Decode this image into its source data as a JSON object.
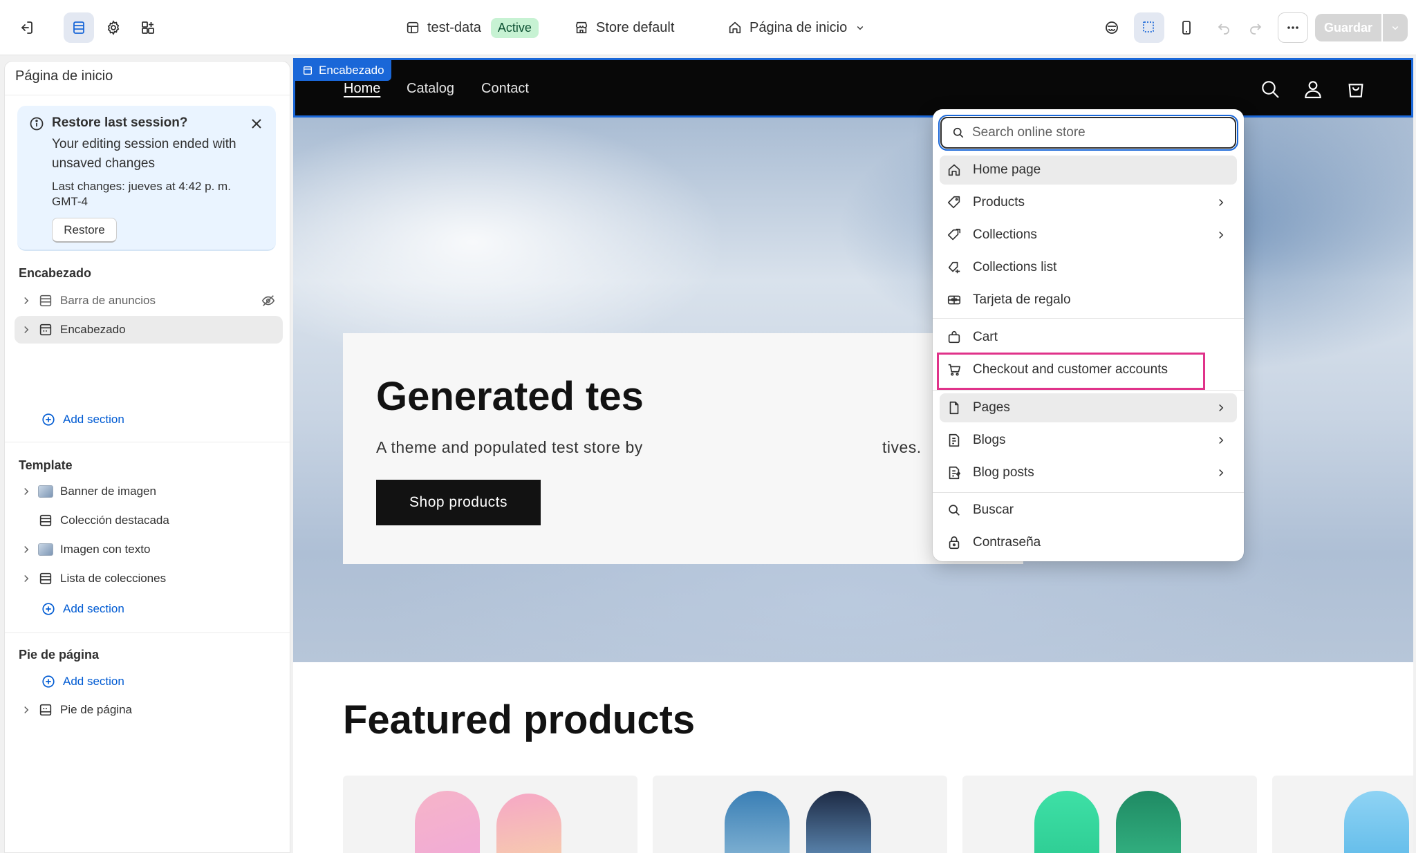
{
  "topbar": {
    "store_name": "test-data",
    "status_badge": "Active",
    "store_theme": "Store default",
    "page_selector": "Página de inicio",
    "save_label": "Guardar"
  },
  "sidebar": {
    "title": "Página de inicio",
    "restore": {
      "title": "Restore last session?",
      "message": "Your editing session ended with unsaved changes",
      "last_changes": "Last changes: jueves at 4:42 p. m. GMT-4",
      "button": "Restore"
    },
    "header_group": {
      "heading": "Encabezado",
      "items": [
        "Barra de anuncios",
        "Encabezado"
      ],
      "add_label": "Add section"
    },
    "template_group": {
      "heading": "Template",
      "items": [
        "Banner de imagen",
        "Colección destacada",
        "Imagen con texto",
        "Lista de colecciones"
      ],
      "add_label": "Add section"
    },
    "footer_group": {
      "heading": "Pie de página",
      "add_label": "Add section",
      "items": [
        "Pie de página"
      ]
    }
  },
  "preview": {
    "selection_tag": "Encabezado",
    "nav": [
      "Home",
      "Catalog",
      "Contact"
    ],
    "hero": {
      "title": "Generated tes",
      "subtitle": "A theme and populated test store by",
      "subtitle_tail": "tives.",
      "button": "Shop products"
    },
    "featured_title": "Featured products"
  },
  "dropdown": {
    "search_placeholder": "Search online store",
    "items": [
      {
        "label": "Home page",
        "icon": "home-icon",
        "submenu": false
      },
      {
        "label": "Products",
        "icon": "tag-icon",
        "submenu": true
      },
      {
        "label": "Collections",
        "icon": "collection-icon",
        "submenu": true
      },
      {
        "label": "Collections list",
        "icon": "collection-list-icon",
        "submenu": false
      },
      {
        "label": "Tarjeta de regalo",
        "icon": "gift-card-icon",
        "submenu": false
      },
      {
        "label": "Cart",
        "icon": "bag-icon",
        "submenu": false
      },
      {
        "label": "Checkout and customer accounts",
        "icon": "cart-icon",
        "submenu": false
      },
      {
        "label": "Pages",
        "icon": "page-icon",
        "submenu": true
      },
      {
        "label": "Blogs",
        "icon": "blog-icon",
        "submenu": true
      },
      {
        "label": "Blog posts",
        "icon": "blog-post-icon",
        "submenu": true
      },
      {
        "label": "Buscar",
        "icon": "search-icon",
        "submenu": false
      },
      {
        "label": "Contraseña",
        "icon": "lock-icon",
        "submenu": false
      }
    ]
  },
  "colors": {
    "accent_blue": "#1a67d8",
    "link_blue": "#005bd3",
    "highlight_pink": "#e0338a",
    "active_badge_bg": "#c7f2d3"
  }
}
